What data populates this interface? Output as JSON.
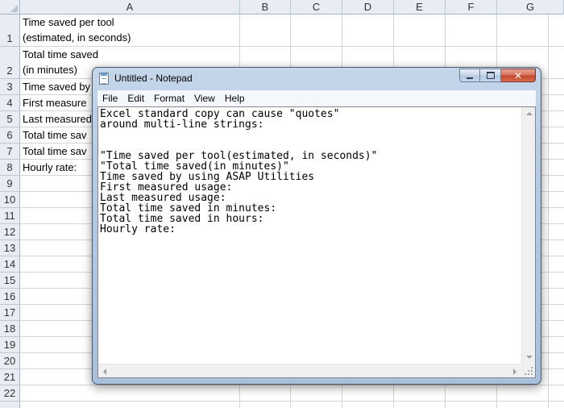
{
  "spreadsheet": {
    "columns": [
      "A",
      "B",
      "C",
      "D",
      "E",
      "F",
      "G"
    ],
    "rows": [
      "1",
      "2",
      "3",
      "4",
      "5",
      "6",
      "7",
      "8",
      "9",
      "10",
      "11",
      "12",
      "13",
      "14",
      "15",
      "16",
      "17",
      "18",
      "19",
      "20",
      "21",
      "22"
    ],
    "cells": {
      "a1_line1": "Time saved per tool",
      "a1_line2": "(estimated, in seconds)",
      "a2_line1": "Total time saved",
      "a2_line2": "(in minutes)",
      "a3": "Time saved by",
      "a4": "First measure",
      "a5": "Last measured",
      "a6": "Total time sav",
      "a7": "Total time sav",
      "a8": "Hourly rate:"
    }
  },
  "notepad": {
    "title": "Untitled - Notepad",
    "menu": [
      "File",
      "Edit",
      "Format",
      "View",
      "Help"
    ],
    "content": "Excel standard copy can cause \"quotes\"\naround multi-line strings:\n\n\n\"Time saved per tool(estimated, in seconds)\"\n\"Total time saved(in minutes)\"\nTime saved by using ASAP Utilities\nFirst measured usage:\nLast measured usage:\nTotal time saved in minutes:\nTotal time saved in hours:\nHourly rate:",
    "close_glyph": "✕"
  },
  "icons": {
    "app": "notepad-icon",
    "minimize": "minimize-icon",
    "maximize": "maximize-icon",
    "close": "close-icon"
  },
  "colors": {
    "close_button": "#c0462c",
    "header_bg": "#e9edf3",
    "gridline": "#d4d4d4"
  }
}
